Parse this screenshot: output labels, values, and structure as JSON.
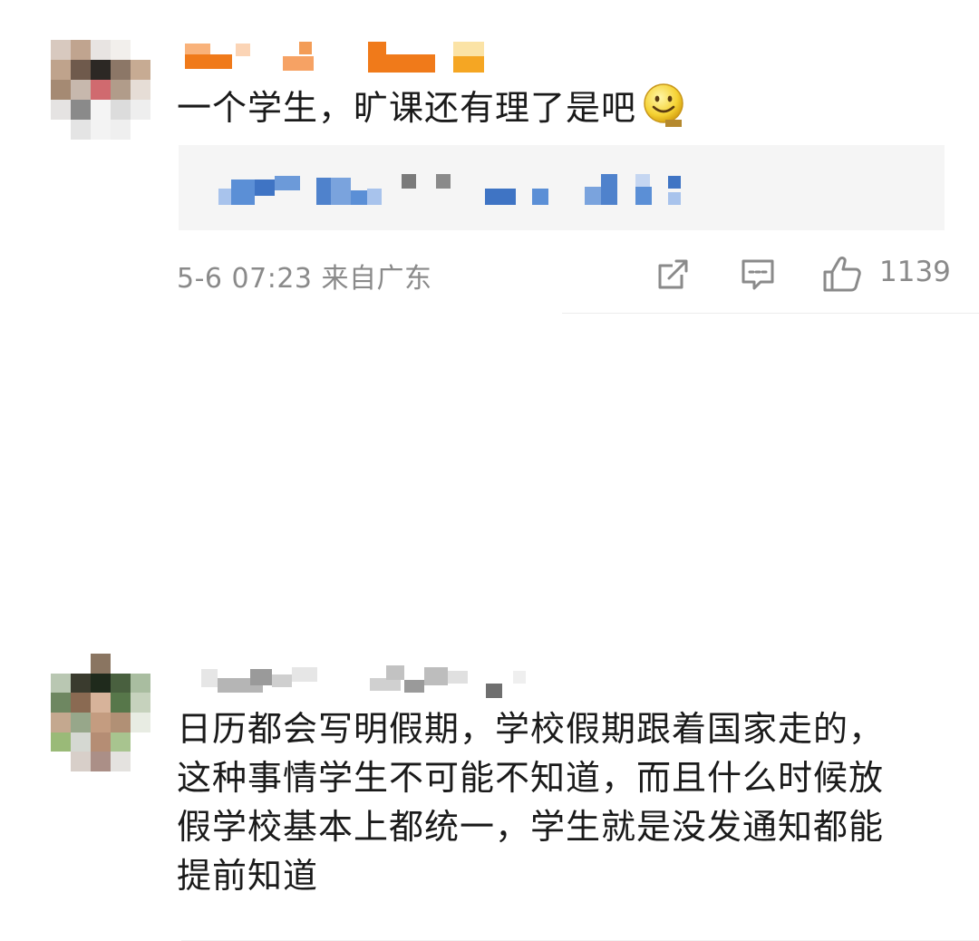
{
  "comments": [
    {
      "username": "",
      "text": "一个学生，旷课还有理了是吧",
      "emoji": "smile-emoji",
      "reply_preview": "",
      "time": "5-6 07:23",
      "location": "来自广东",
      "actions": {
        "share_icon": "share-icon",
        "comment_icon": "comment-icon",
        "like_icon": "thumbs-up-icon",
        "like_count": "1139"
      }
    },
    {
      "username": "",
      "text_lines": [
        "日历都会写明假期，学校假期跟着国家走的，",
        "这种事情学生不可能不知道，而且什么时候放",
        "假学校基本上都统一，学生就是没发通知都能",
        "提前知道"
      ]
    }
  ],
  "colors": {
    "text": "#1a1a1a",
    "meta": "#8a8a8a",
    "reply_bg": "#f5f5f5",
    "username_orange": "#f07a1a",
    "username_gray": "#b5b5b5",
    "blur_blue": "#5b8fd6"
  }
}
